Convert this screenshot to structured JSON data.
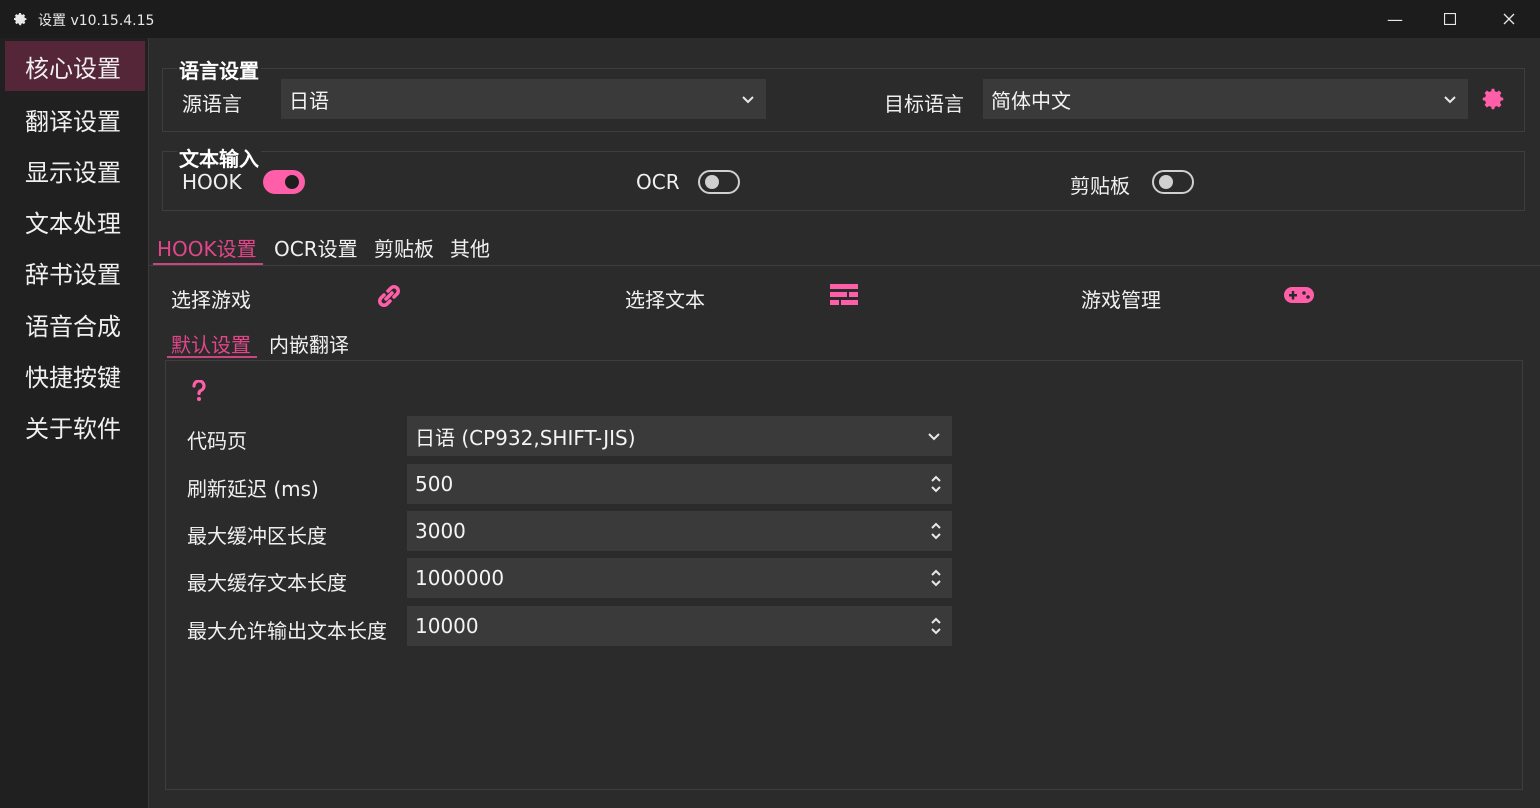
{
  "window": {
    "title": "设置 v10.15.4.15",
    "minimize": "—",
    "maximize": "☐",
    "close": "✕"
  },
  "sidebar": {
    "items": [
      {
        "label": "核心设置",
        "active": true
      },
      {
        "label": "翻译设置"
      },
      {
        "label": "显示设置"
      },
      {
        "label": "文本处理"
      },
      {
        "label": "辞书设置"
      },
      {
        "label": "语音合成"
      },
      {
        "label": "快捷按键"
      },
      {
        "label": "关于软件"
      }
    ]
  },
  "language": {
    "group_title": "语言设置",
    "source_label": "源语言",
    "source_value": "日语",
    "target_label": "目标语言",
    "target_value": "简体中文",
    "settings_icon": "gear-icon"
  },
  "text_input": {
    "group_title": "文本输入",
    "hook_label": "HOOK",
    "hook_on": true,
    "ocr_label": "OCR",
    "ocr_on": false,
    "clipboard_label": "剪贴板",
    "clipboard_on": false
  },
  "tabs": [
    {
      "label": "HOOK设置",
      "active": true
    },
    {
      "label": "OCR设置"
    },
    {
      "label": "剪贴板"
    },
    {
      "label": "其他"
    }
  ],
  "hook_actions": {
    "select_game": "选择游戏",
    "select_game_icon": "link-icon",
    "select_text": "选择文本",
    "select_text_icon": "list-icon",
    "game_manage": "游戏管理",
    "game_manage_icon": "gamepad-icon"
  },
  "subtabs": [
    {
      "label": "默认设置",
      "active": true
    },
    {
      "label": "内嵌翻译"
    }
  ],
  "defaults": {
    "help_icon": "question-icon",
    "codepage_label": "代码页",
    "codepage_value": "日语 (CP932,SHIFT-JIS)",
    "refresh_label": "刷新延迟 (ms)",
    "refresh_value": "500",
    "maxbuf_label": "最大缓冲区长度",
    "maxbuf_value": "3000",
    "maxcache_label": "最大缓存文本长度",
    "maxcache_value": "1000000",
    "maxout_label": "最大允许输出文本长度",
    "maxout_value": "10000"
  },
  "colors": {
    "accent": "#ff5fa8",
    "active_sidebar": "#552538",
    "background": "#2b2b2b"
  }
}
